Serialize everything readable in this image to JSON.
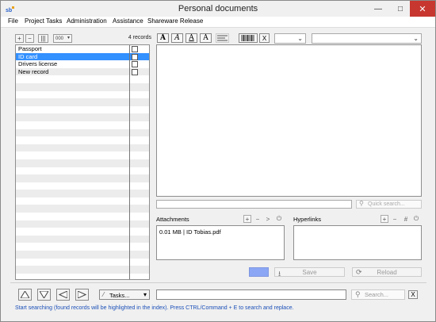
{
  "window": {
    "title": "Personal documents",
    "controls": {
      "minimize": "—",
      "maximize": "□",
      "close": "✕"
    }
  },
  "menu": [
    "File",
    "Project Tasks",
    "Administration",
    "Assistance",
    "Shareware Release"
  ],
  "records_panel": {
    "toolbar": {
      "add": "+",
      "remove": "−",
      "columns": "|||",
      "options": "000"
    },
    "count": "4 records",
    "records": [
      {
        "label": "Passport",
        "checked": false,
        "selected": false
      },
      {
        "label": "ID card",
        "checked": false,
        "selected": true
      },
      {
        "label": "Drivers license",
        "checked": false,
        "selected": false
      },
      {
        "label": "New record",
        "checked": false,
        "selected": false
      }
    ]
  },
  "format_toolbar": {
    "styles": [
      "A",
      "A",
      "A",
      "A"
    ],
    "align_icon": "align-lines-icon",
    "barcode_icon": "barcode-icon",
    "clear_format": "X"
  },
  "editor": {
    "quick_search_placeholder": "Quick search..."
  },
  "attachments": {
    "label": "Attachments",
    "items": [
      "0.01 MB | ID Tobias.pdf"
    ],
    "buttons": {
      "add": "+",
      "remove": "−",
      "open": ">",
      "power": "⏻"
    }
  },
  "hyperlinks": {
    "label": "Hyperlinks",
    "buttons": {
      "add": "+",
      "remove": "−",
      "hash": "#",
      "power": "⏻"
    }
  },
  "actions": {
    "color": "#8aa6f5",
    "save_label": "Save",
    "reload_label": "Reload"
  },
  "bottom_bar": {
    "tasks_label": "Tasks...",
    "search_placeholder": "Search...",
    "clear": "X"
  },
  "status_text": "Start searching (found records will be highlighted in the index). Press CTRL/Command + E to search and replace."
}
